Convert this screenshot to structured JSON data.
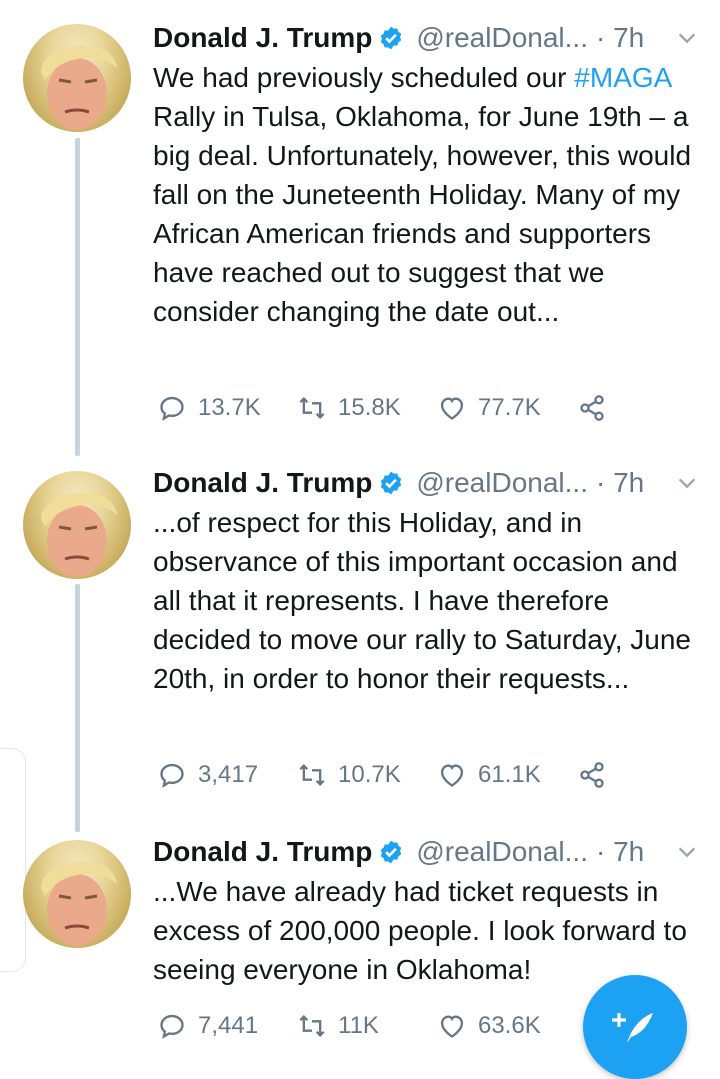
{
  "tweets": [
    {
      "name": "Donald J. Trump",
      "handle": "@realDonal...",
      "time": "· 7h",
      "text_before_tag": "We had previously scheduled our ",
      "hashtag": "#MAGA",
      "text_after_tag": " Rally in Tulsa, Oklahoma, for June 19th – a big deal. Unfortunately, however, this would fall on the Juneteenth Holiday. Many of my African American friends and supporters have reached out to suggest that we consider changing the date out...",
      "replies": "13.7K",
      "retweets": "15.8K",
      "likes": "77.7K"
    },
    {
      "name": "Donald J. Trump",
      "handle": "@realDonal...",
      "time": "· 7h",
      "text": "...of respect for this Holiday, and in observance of this important occasion and all that it represents. I have therefore decided to move our rally to Saturday, June 20th, in order to honor their requests...",
      "replies": "3,417",
      "retweets": "10.7K",
      "likes": "61.1K"
    },
    {
      "name": "Donald J. Trump",
      "handle": "@realDonal...",
      "time": "· 7h",
      "text": "...We have already had ticket requests in excess of 200,000 people. I look forward to seeing everyone in Oklahoma!",
      "replies": "7,441",
      "retweets": "11K",
      "likes": "63.6K"
    }
  ],
  "icons": {
    "verified": "verified-badge-icon",
    "caret": "chevron-down-icon",
    "reply": "reply-icon",
    "retweet": "retweet-icon",
    "like": "heart-icon",
    "share": "share-icon",
    "compose": "compose-tweet-icon"
  },
  "colors": {
    "accent": "#1da1f2",
    "muted": "#657786",
    "text": "#14171a",
    "thread_line": "#c5d3de"
  }
}
